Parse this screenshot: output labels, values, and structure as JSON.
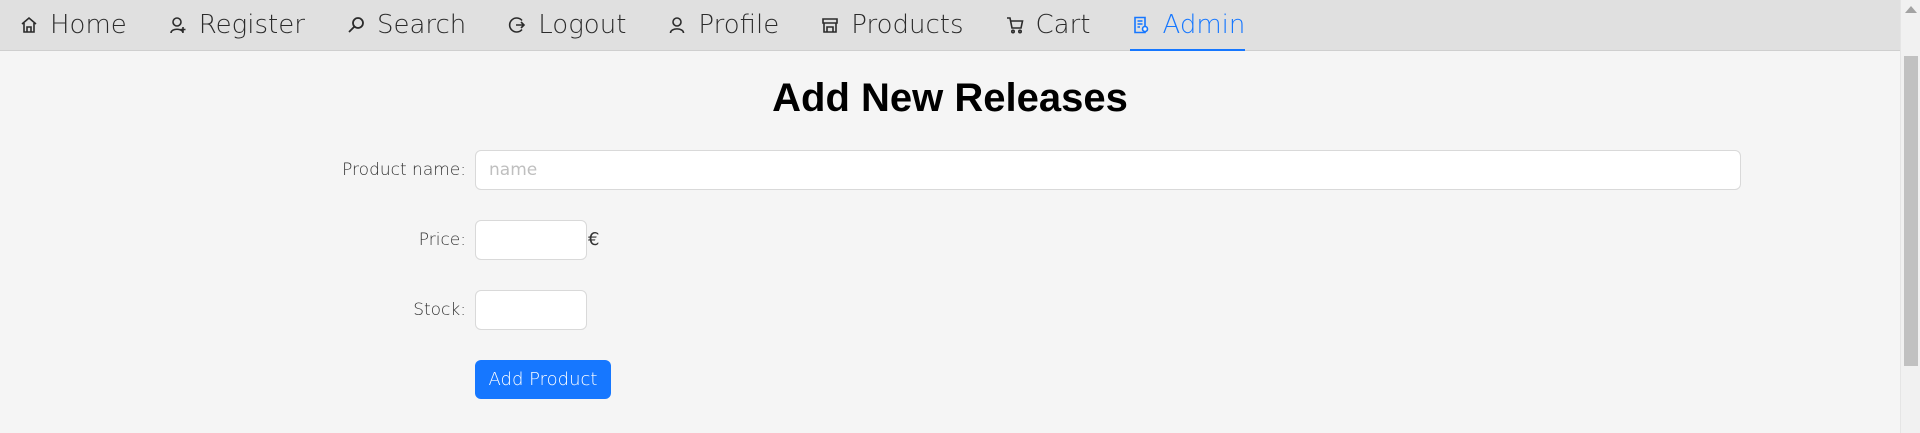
{
  "nav": {
    "items": [
      {
        "label": "Home",
        "icon": "home-icon"
      },
      {
        "label": "Register",
        "icon": "user-add-icon"
      },
      {
        "label": "Search",
        "icon": "search-icon"
      },
      {
        "label": "Logout",
        "icon": "logout-icon"
      },
      {
        "label": "Profile",
        "icon": "user-icon"
      },
      {
        "label": "Products",
        "icon": "shop-icon"
      },
      {
        "label": "Cart",
        "icon": "cart-icon"
      },
      {
        "label": "Admin",
        "icon": "admin-icon"
      }
    ],
    "active": "Admin"
  },
  "page": {
    "title": "Add New Releases"
  },
  "form": {
    "name_label": "Product name",
    "name_placeholder": "name",
    "name_value": "",
    "price_label": "Price",
    "price_value": "",
    "price_suffix": "€",
    "stock_label": "Stock",
    "stock_value": "",
    "submit_label": "Add Product"
  },
  "colors": {
    "accent": "#1677ff",
    "nav_bg": "#e0e0e0",
    "page_bg": "#f5f5f5"
  }
}
